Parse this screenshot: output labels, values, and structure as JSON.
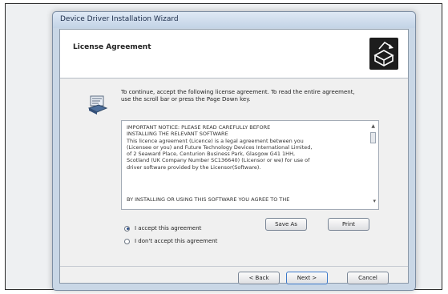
{
  "window": {
    "title": "Device Driver Installation Wizard"
  },
  "header": {
    "title": "License Agreement",
    "icon": "installer-box-icon"
  },
  "instruction": "To continue, accept the following license agreement. To read the entire agreement, use the scroll bar or press the Page Down key.",
  "license": {
    "text": "IMPORTANT NOTICE: PLEASE READ CAREFULLY BEFORE\nINSTALLING THE RELEVANT SOFTWARE\nThis licence agreement (Licence) is a legal agreement between you\n(Licensee or you) and Future Technology Devices International Limited,\nof 2 Seaward Place, Centurion Business Park, Glasgow G41 1HH,\nScotland (UK Company Number SC136640) (Licensor or we) for use of\ndriver software provided by the Licensor(Software).",
    "footer": "BY INSTALLING OR USING THIS SOFTWARE YOU AGREE TO THE"
  },
  "options": {
    "accept": "I accept this agreement",
    "decline": "I don't accept this agreement",
    "selected": "accept"
  },
  "buttons": {
    "save_as": "Save As",
    "print": "Print",
    "back": "< Back",
    "next": "Next >",
    "cancel": "Cancel"
  },
  "colors": {
    "title_bar": "#c3d3e6",
    "accent": "#3b78c9"
  }
}
